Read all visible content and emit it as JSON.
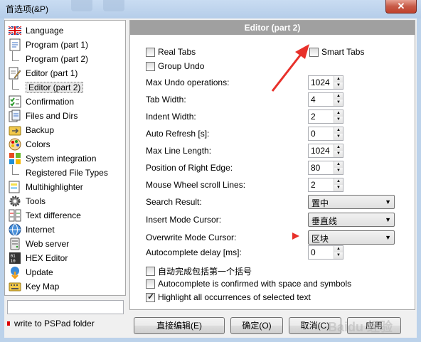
{
  "window": {
    "title": "首选项(&P)",
    "close": "✕"
  },
  "tree": {
    "items": [
      {
        "label": "Language",
        "icon": "uk-flag-icon"
      },
      {
        "label": "Program  (part 1)",
        "icon": "document-icon"
      },
      {
        "label": "Program  (part 2)",
        "child": true
      },
      {
        "label": "Editor  (part 1)",
        "icon": "edit-document-icon"
      },
      {
        "label": "Editor  (part 2)",
        "child": true,
        "selected": true
      },
      {
        "label": "Confirmation",
        "icon": "checklist-icon"
      },
      {
        "label": "Files and Dirs",
        "icon": "files-icon"
      },
      {
        "label": "Backup",
        "icon": "backup-icon"
      },
      {
        "label": "Colors",
        "icon": "palette-icon"
      },
      {
        "label": "System integration",
        "icon": "windows-icon"
      },
      {
        "label": "Registered File Types",
        "child": true
      },
      {
        "label": "Multihighlighter",
        "icon": "highlighter-icon"
      },
      {
        "label": "Tools",
        "icon": "gear-icon"
      },
      {
        "label": "Text difference",
        "icon": "diff-icon"
      },
      {
        "label": "Internet",
        "icon": "globe-icon"
      },
      {
        "label": "Web server",
        "icon": "server-icon"
      },
      {
        "label": "HEX Editor",
        "icon": "hex-icon"
      },
      {
        "label": "Update",
        "icon": "update-icon"
      },
      {
        "label": "Key Map",
        "icon": "keyboard-icon"
      }
    ],
    "folder_label": "write to PSPad folder"
  },
  "panel": {
    "title": "Editor  (part 2)",
    "real_tabs": "Real Tabs",
    "smart_tabs": "Smart Tabs",
    "group_undo": "Group Undo",
    "spins": [
      {
        "label": "Max Undo operations:",
        "value": "1024"
      },
      {
        "label": "Tab Width:",
        "value": "4"
      },
      {
        "label": "Indent Width:",
        "value": "2"
      },
      {
        "label": "Auto Refresh [s]:",
        "value": "0"
      },
      {
        "label": "Max Line Length:",
        "value": "1024"
      },
      {
        "label": "Position of Right Edge:",
        "value": "80"
      },
      {
        "label": "Mouse Wheel scroll Lines:",
        "value": "2"
      }
    ],
    "combos": [
      {
        "label": "Search Result:",
        "value": "置中"
      },
      {
        "label": "Insert Mode Cursor:",
        "value": "垂直线"
      },
      {
        "label": "Overwrite Mode Cursor:",
        "value": "区块"
      }
    ],
    "autocomplete_delay": {
      "label": "Autocomplete delay [ms]:",
      "value": "0"
    },
    "checks": [
      {
        "label": "自动完成包括第一个括号",
        "checked": false
      },
      {
        "label": "Autocomplete is confirmed with space and symbols",
        "checked": false
      },
      {
        "label": "Highlight all occurrences of selected text",
        "checked": true
      }
    ]
  },
  "buttons": {
    "direct_edit": "直接编辑(E)",
    "ok": "确定(O)",
    "cancel": "取消(C)",
    "apply": "应用"
  },
  "annotation_color": "#e8302a",
  "watermark": "Baidu 经验"
}
